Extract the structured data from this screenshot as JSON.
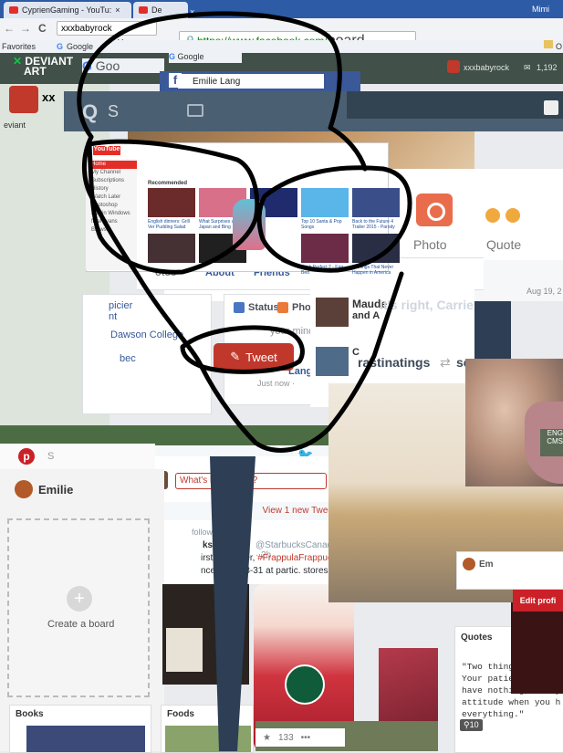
{
  "browser": {
    "tabs": [
      "CyprienGaming - YouTu:",
      "De"
    ],
    "tab_close": "×",
    "omnibox_url_1": "xxxbabyrock",
    "omnibox_url_2": "https://www.facebook.com/",
    "omnibox_url_2_suffix": "board",
    "back_glyph": "←",
    "forward_glyph": "→",
    "reload_glyph": "C",
    "user_label": "Mimi",
    "bookmarks": [
      {
        "label": "Favorites"
      },
      {
        "label": "Google"
      },
      {
        "label": "Google"
      }
    ],
    "bookmark_large_google": "Goo",
    "https_label": "https:",
    "bookmark_right": "O"
  },
  "deviantart": {
    "logo_line1": "DEVIANT",
    "logo_line2": "ART",
    "user": "xxxbabyrock",
    "count": "1,192",
    "side_label": "eviant",
    "xx": "xx",
    "search_glyph": "Q",
    "search_partial": "S"
  },
  "facebook": {
    "search_value": "Emilie Lang",
    "nav": [
      "About",
      "Friends"
    ],
    "nav_partial": "otos",
    "composer": {
      "status": "Status",
      "photo": "Photo",
      "prompt": "your mind"
    },
    "intro_lines": [
      "picier",
      "nt",
      "Dawson College",
      "bec"
    ],
    "post_time": "Just now · ",
    "post_name": "Lang",
    "actions": [
      {
        "label": "Photo",
        "icon": "camera-icon"
      },
      {
        "label": "Quote",
        "icon": "quote-icon"
      }
    ],
    "date": "Aug 19, 2",
    "ticker": [
      {
        "name": "Maude",
        "text": "it's right, Carrie",
        "sub": "and A"
      },
      {
        "name": "C",
        "text": "rastinatings",
        "retweet": "sen"
      }
    ]
  },
  "youtube": {
    "logo": "YouTube",
    "section": "Recommended",
    "sidebar": [
      "Home",
      "My Channel",
      "Subscriptions",
      "History",
      "Watch Later",
      "Photoshop",
      "Kristin Windows",
      "final evans",
      "Browse"
    ],
    "videos": [
      "English dinners: Grill Ver Pudding Salad",
      "What Surprises us with Japan and Bing",
      "",
      "Top 10 Santa & Pop Songs",
      "Back to the Future 4 Trailer 2015 - Parody",
      "",
      "",
      "",
      "Hitch Perfect 2 - Egg Bed",
      "3 Things That Never Happen in America"
    ]
  },
  "twitter": {
    "placeholder": "What's happening?",
    "new_tweets": "View 1 new Twee",
    "followed_label": "followed",
    "tweet_name": "ks Canada",
    "tweet_handle": "@StarbucksCanada · 2h",
    "tweet_text_1": "irst time ever, ",
    "tweet_hashtag": "#FrappulaFrappuccino",
    "tweet_text_1_suffix": " r",
    "tweet_text_2": "nce! Oct. 28-31 at partic. stores.",
    "tweet_button": "Tweet"
  },
  "pinterest": {
    "logo": "p",
    "search_partial": "S",
    "profile_name": "Emilie",
    "create_board": "Create a board",
    "plus": "+",
    "boards": [
      {
        "title": "Books"
      },
      {
        "title": "Foods"
      },
      {
        "title": "Quotes"
      }
    ],
    "quote": "\"Two things define\nYour patience when\nhave nothing, and y\nattitude when you h\neverything.\"",
    "repins": "10",
    "likes": "133",
    "dots": "•••",
    "profile_partial": "Em",
    "edit_profile": "Edit profi",
    "lang_label_1": "ENG",
    "lang_label_2": "CMS"
  },
  "colors": {
    "facebook_blue": "#3b5998",
    "tweet_red": "#c0382b",
    "pinterest_red": "#cb2027",
    "outline": "#000000",
    "slate": "#2d3e55"
  }
}
